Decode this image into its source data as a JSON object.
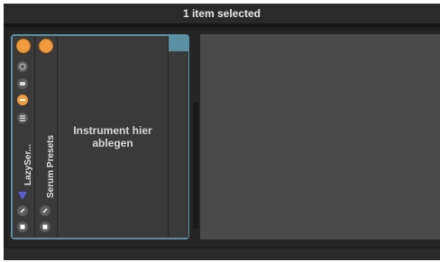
{
  "header": {
    "title": "1 item selected"
  },
  "rack": {
    "chain_1_label": "LazySer...",
    "chain_2_label": "Serum Presets",
    "drop_zone": {
      "line1": "Instrument hier",
      "line2": "ablegen"
    }
  },
  "colors": {
    "accent": "#f29b3c",
    "selection": "#5b8fa3",
    "purple": "#5b5bd6"
  }
}
